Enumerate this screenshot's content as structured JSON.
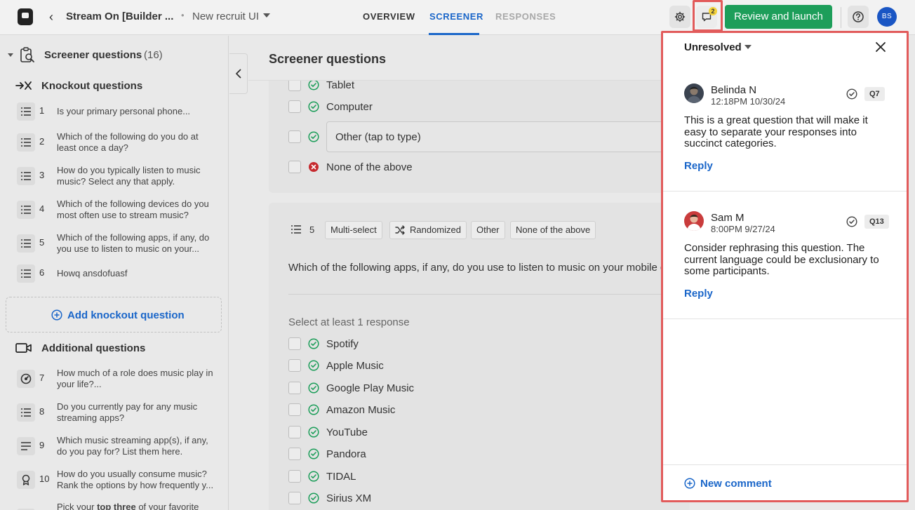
{
  "header": {
    "project_title": "Stream On [Builder ...",
    "separator": "•",
    "recruit_name": "New recruit UI",
    "tabs": [
      {
        "label": "OVERVIEW"
      },
      {
        "label": "SCREENER"
      },
      {
        "label": "RESPONSES"
      }
    ],
    "comment_count": "2",
    "launch_label": "Review and launch",
    "user_initials": "BS",
    "colors": {
      "accent": "#1a66c9",
      "launch": "#1d9e5a",
      "highlight": "#e25b5b"
    }
  },
  "sidebar": {
    "title": "Screener questions",
    "count": "(16)",
    "knockout_title": "Knockout questions",
    "knockout_items": [
      {
        "num": "1",
        "text": "Is your primary personal phone..."
      },
      {
        "num": "2",
        "text": "Which of the following do you do at least once a day?"
      },
      {
        "num": "3",
        "text": "How do you typically listen to music music? Select any that apply."
      },
      {
        "num": "4",
        "text": "Which of the following devices do you most often use to stream music?"
      },
      {
        "num": "5",
        "text": "Which of the following apps, if any, do you use to listen to music on your..."
      },
      {
        "num": "6",
        "text": "Howq ansdofuasf"
      }
    ],
    "add_knockout_label": "Add knockout question",
    "additional_title": "Additional questions",
    "additional_items": [
      {
        "num": "7",
        "text": "How much of a role does music play in your life?..."
      },
      {
        "num": "8",
        "text": "Do you currently pay for any music streaming apps?"
      },
      {
        "num": "9",
        "text": "Which music streaming app(s), if any, do you pay for? List them here."
      },
      {
        "num": "10",
        "text": "How do you usually consume music? Rank the options by how frequently y..."
      },
      {
        "num": "",
        "text_pre": "Pick your ",
        "text_bold": "top three",
        "text_post": " of your favorite"
      }
    ]
  },
  "main": {
    "title": "Screener questions",
    "q4_options": [
      {
        "label": "Tablet",
        "status": "accept"
      },
      {
        "label": "Computer",
        "status": "accept"
      },
      {
        "label": "Other (tap to type)",
        "status": "accept"
      },
      {
        "label": "None of the above",
        "status": "reject"
      }
    ],
    "q5": {
      "num": "5",
      "tags": [
        "Multi-select",
        "Randomized",
        "Other",
        "None of the above"
      ],
      "text": "Which of the following apps, if any, do you use to listen to music on your mobile dev",
      "hint": "Select at least 1 response",
      "options": [
        "Spotify",
        "Apple Music",
        "Google Play Music",
        "Amazon Music",
        "YouTube",
        "Pandora",
        "TIDAL",
        "Sirius XM"
      ]
    }
  },
  "comments_panel": {
    "filter_label": "Unresolved",
    "comments": [
      {
        "author": "Belinda N",
        "time": "12:18PM 10/30/24",
        "question_tag": "Q7",
        "body": "This is a great question that will make it easy to separate your responses into succinct categories.",
        "reply_label": "Reply"
      },
      {
        "author": "Sam M",
        "time": "8:00PM 9/27/24",
        "question_tag": "Q13",
        "body": "Consider rephrasing this question. The current language could be exclusionary to some participants.",
        "reply_label": "Reply"
      }
    ],
    "new_comment_label": "New comment"
  }
}
